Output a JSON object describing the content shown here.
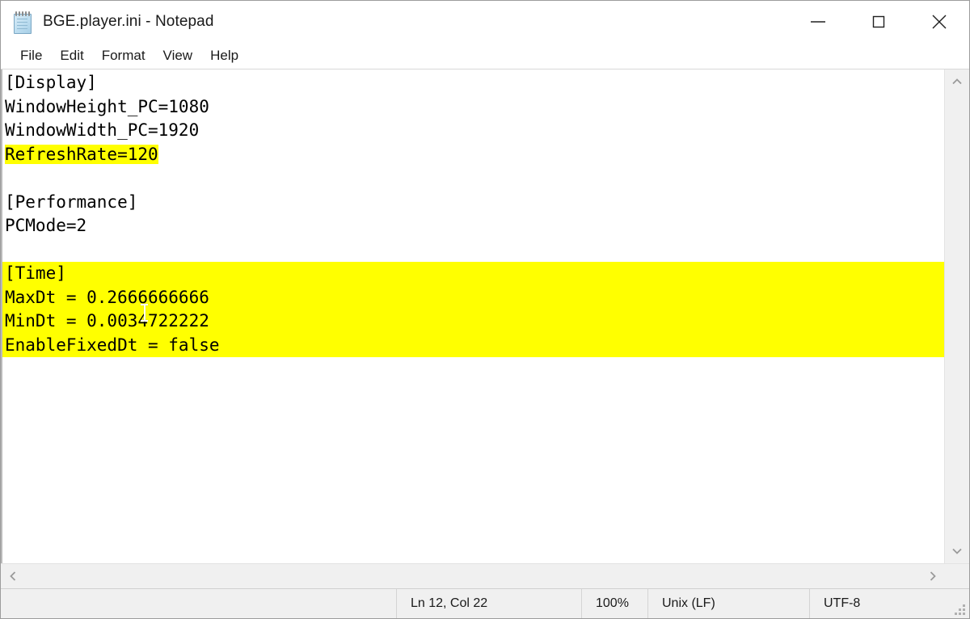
{
  "window": {
    "title": "BGE.player.ini - Notepad",
    "icon": "notepad-icon",
    "controls": {
      "minimize": "minimize-icon",
      "maximize": "maximize-icon",
      "close": "close-icon"
    }
  },
  "menubar": {
    "items": [
      {
        "label": "File"
      },
      {
        "label": "Edit"
      },
      {
        "label": "Format"
      },
      {
        "label": "View"
      },
      {
        "label": "Help"
      }
    ]
  },
  "document": {
    "highlight_color": "#ffff00",
    "lines": [
      {
        "text": "[Display]",
        "highlight": "none"
      },
      {
        "text": "WindowHeight_PC=1080",
        "highlight": "none"
      },
      {
        "text": "WindowWidth_PC=1920",
        "highlight": "none"
      },
      {
        "text": "RefreshRate=120",
        "highlight": "inline"
      },
      {
        "text": "",
        "highlight": "none"
      },
      {
        "text": "[Performance]",
        "highlight": "none"
      },
      {
        "text": "PCMode=2",
        "highlight": "none"
      },
      {
        "text": "",
        "highlight": "none"
      },
      {
        "text": "[Time]",
        "highlight": "block"
      },
      {
        "text": "MaxDt = 0.2666666666",
        "highlight": "block"
      },
      {
        "text": "MinDt = 0.0034722222",
        "highlight": "block"
      },
      {
        "text": "EnableFixedDt = false",
        "highlight": "block"
      }
    ]
  },
  "scrollbars": {
    "vertical": {
      "up_arrow": "chevron-up-icon",
      "down_arrow": "chevron-down-icon"
    },
    "horizontal": {
      "left_arrow": "chevron-left-icon",
      "right_arrow": "chevron-right-icon"
    }
  },
  "statusbar": {
    "cursor_position": "Ln 12, Col 22",
    "zoom": "100%",
    "line_ending": "Unix (LF)",
    "encoding": "UTF-8",
    "resize_grip": "resize-grip-icon"
  }
}
